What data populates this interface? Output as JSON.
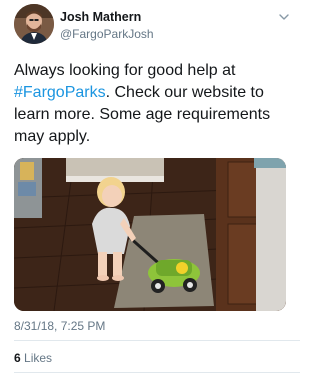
{
  "author": {
    "name": "Josh Mathern",
    "handle": "@FargoParkJosh",
    "avatar_icon": "profile-photo"
  },
  "menu_icon": "chevron-down-icon",
  "tweet": {
    "text_before": "Always looking for good help at ",
    "hashtag": "#FargoParks",
    "text_after": ". Check our website to learn more. Some age requirements may apply.",
    "hashtag_color": "#1b95e0"
  },
  "media": {
    "subject": "photo-toddler-with-toy-lawnmower"
  },
  "timestamp": "8/31/18, 7:25 PM",
  "stats": {
    "likes_count": "6",
    "likes_label": "Likes"
  }
}
